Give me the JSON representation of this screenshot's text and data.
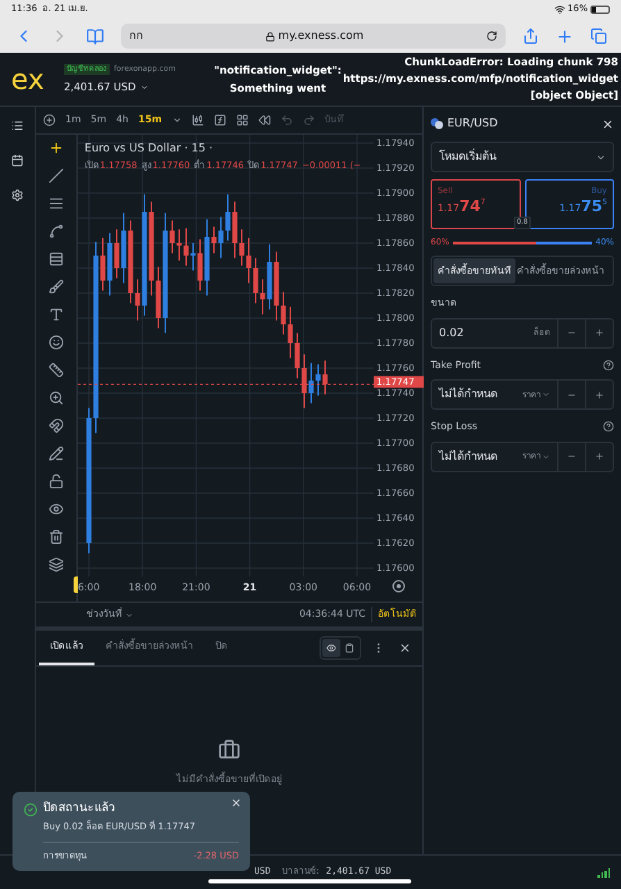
{
  "status_bar": {
    "time": "11:36",
    "date": "อ. 21 เม.ย.",
    "battery": "16%"
  },
  "browser": {
    "text_size_button": "กก",
    "address": "my.exness.com"
  },
  "header": {
    "logo": "ex",
    "account_badge": "บัญชีทดลอง",
    "server": "forexonapp.com",
    "balance": "2,401.67 USD",
    "widget_error": [
      "\"notification_widget\":",
      "Something went"
    ],
    "chunk_error": [
      "ChunkLoadError: Loading chunk 798",
      "https://my.exness.com/mfp/notification_widget",
      "[object Object]"
    ]
  },
  "chart_toolbar": {
    "timeframes": [
      {
        "label": "1m",
        "selected": false
      },
      {
        "label": "5m",
        "selected": false
      },
      {
        "label": "4h",
        "selected": false
      },
      {
        "label": "15m",
        "selected": true
      }
    ],
    "save_label": "บันทึ"
  },
  "chart": {
    "title": "Euro vs US Dollar · 15 ·",
    "ohlc": [
      {
        "label": "เปิด",
        "value": "1.17758"
      },
      {
        "label": "สูง",
        "value": "1.17760"
      },
      {
        "label": "ต่ำ",
        "value": "1.17746"
      },
      {
        "label": "ปิด",
        "value": "1.17747"
      }
    ],
    "change": "−0.00011 (−",
    "current_price": "1.17747",
    "chart_data": {
      "type": "candlestick",
      "ylim": [
        1.176,
        1.1794
      ],
      "grid": true,
      "ref_lines": [
        {
          "axis": "y",
          "value": 1.17747,
          "color": "#e04848"
        }
      ],
      "yticks": [
        {
          "value": 1.1794,
          "label": "1.17940"
        },
        {
          "value": 1.1792,
          "label": "1.17920"
        },
        {
          "value": 1.179,
          "label": "1.17900"
        },
        {
          "value": 1.1788,
          "label": "1.17880"
        },
        {
          "value": 1.1786,
          "label": "1.17860"
        },
        {
          "value": 1.1784,
          "label": "1.17840"
        },
        {
          "value": 1.1782,
          "label": "1.17820"
        },
        {
          "value": 1.178,
          "label": "1.17800"
        },
        {
          "value": 1.1778,
          "label": "1.17780"
        },
        {
          "value": 1.1776,
          "label": "1.17760"
        },
        {
          "value": 1.1774,
          "label": "1.17740"
        },
        {
          "value": 1.1772,
          "label": "1.17720"
        },
        {
          "value": 1.177,
          "label": "1.17700"
        },
        {
          "value": 1.1768,
          "label": "1.17680"
        },
        {
          "value": 1.1766,
          "label": "1.17660"
        },
        {
          "value": 1.1764,
          "label": "1.17640"
        },
        {
          "value": 1.1762,
          "label": "1.17620"
        },
        {
          "value": 1.176,
          "label": "1.17600"
        }
      ],
      "categories": [
        null,
        null,
        null,
        null,
        null,
        null,
        null,
        null,
        null,
        null,
        null,
        null,
        null,
        null,
        null,
        null,
        null,
        null,
        null,
        null,
        null,
        null,
        null,
        null,
        null,
        null,
        null,
        null,
        null,
        null,
        null,
        null,
        null,
        null,
        null
      ],
      "ohlc": [
        [
          1.1762,
          1.17728,
          1.17612,
          1.1772
        ],
        [
          1.1772,
          1.17861,
          1.17708,
          1.1785
        ],
        [
          1.1785,
          1.17864,
          1.17822,
          1.1783
        ],
        [
          1.1783,
          1.17868,
          1.17818,
          1.1786
        ],
        [
          1.1786,
          1.17871,
          1.17832,
          1.1784
        ],
        [
          1.1784,
          1.17884,
          1.17828,
          1.1787
        ],
        [
          1.1787,
          1.17878,
          1.17812,
          1.1782
        ],
        [
          1.1782,
          1.17831,
          1.17798,
          1.1781
        ],
        [
          1.1781,
          1.17899,
          1.17802,
          1.17885
        ],
        [
          1.17885,
          1.17893,
          1.17818,
          1.1783
        ],
        [
          1.1783,
          1.17841,
          1.17792,
          1.178
        ],
        [
          1.178,
          1.17884,
          1.17788,
          1.1787
        ],
        [
          1.1787,
          1.17878,
          1.17852,
          1.1786
        ],
        [
          1.1786,
          1.17871,
          1.17846,
          1.17858
        ],
        [
          1.17858,
          1.17872,
          1.17842,
          1.1785
        ],
        [
          1.1785,
          1.1786,
          1.17838,
          1.17852
        ],
        [
          1.17852,
          1.17863,
          1.17822,
          1.1783
        ],
        [
          1.1783,
          1.17879,
          1.17818,
          1.17865
        ],
        [
          1.17865,
          1.17873,
          1.17852,
          1.1786
        ],
        [
          1.1786,
          1.17881,
          1.17848,
          1.1787
        ],
        [
          1.1787,
          1.17899,
          1.17862,
          1.17885
        ],
        [
          1.17885,
          1.17893,
          1.17848,
          1.1786
        ],
        [
          1.1786,
          1.17871,
          1.17842,
          1.1785
        ],
        [
          1.1785,
          1.17864,
          1.17828,
          1.1784
        ],
        [
          1.1784,
          1.17848,
          1.17812,
          1.1782
        ],
        [
          1.1782,
          1.17831,
          1.17803,
          1.17815
        ],
        [
          1.17815,
          1.17859,
          1.17807,
          1.17845
        ],
        [
          1.17845,
          1.17853,
          1.17798,
          1.1781
        ],
        [
          1.1781,
          1.17821,
          1.17787,
          1.17795
        ],
        [
          1.17795,
          1.17809,
          1.17768,
          1.1778
        ],
        [
          1.1778,
          1.17788,
          1.17752,
          1.1776
        ],
        [
          1.1776,
          1.17771,
          1.17728,
          1.1774
        ],
        [
          1.1774,
          1.17764,
          1.17732,
          1.1775
        ],
        [
          1.1775,
          1.17763,
          1.17738,
          1.17755
        ],
        [
          1.17755,
          1.17766,
          1.17739,
          1.17747
        ]
      ]
    },
    "time_labels": [
      {
        "label": "6:00",
        "bold": false
      },
      {
        "label": "18:00",
        "bold": false
      },
      {
        "label": "21:00",
        "bold": false
      },
      {
        "label": "21",
        "bold": true
      },
      {
        "label": "03:00",
        "bold": false
      },
      {
        "label": "06:00",
        "bold": false
      }
    ],
    "range_button": "ช่วงวันที่",
    "clock": "04:36:44 UTC",
    "auto_button": "อัตโนมัติ"
  },
  "order_panel": {
    "symbol": "EUR/USD",
    "mode": "โหมดเริ่มต้น",
    "quotes": [
      {
        "kind": "sell",
        "label": "Sell",
        "price_prefix": "1.17",
        "price_big": "74",
        "price_sup": "7"
      },
      {
        "kind": "buy",
        "label": "Buy",
        "price_prefix": "1.17",
        "price_big": "75",
        "price_sup": "5"
      }
    ],
    "spread": "0.8",
    "sentiment": {
      "sell": "60%",
      "buy": "40%",
      "level": 0.6
    },
    "order_types": [
      {
        "label": "คำสั่งซื้อขายทันที",
        "selected": true
      },
      {
        "label": "คำสั่งซื้อขายล่วงหน้า",
        "selected": false
      }
    ],
    "volume": {
      "label": "ขนาด",
      "value": "0.02",
      "unit": "ล็อต"
    },
    "take_profit": {
      "label": "Take Profit",
      "value": "ไม่ได้กำหนด",
      "unit": "ราคา"
    },
    "stop_loss": {
      "label": "Stop Loss",
      "value": "ไม่ได้กำหนด",
      "unit": "ราคา"
    }
  },
  "positions_panel": {
    "view_modes": [
      {
        "selected": true
      },
      {
        "selected": false
      }
    ],
    "tabs": [
      {
        "label": "เปิดแล้ว",
        "selected": true
      },
      {
        "label": "คำสั่งซื้อขายล่วงหน้า",
        "selected": false
      },
      {
        "label": "ปิด",
        "selected": false
      }
    ],
    "empty_message": "ไม่มีคำสั่งซื้อขายที่เปิดอยู่"
  },
  "toast": {
    "title": "ปิดสถานะแล้ว",
    "detail": "Buy 0.02 ล็อต EUR/USD ที่ 1.17747",
    "loss_label": "การขาดทุน",
    "loss_value": "-2.28 USD"
  },
  "footer": {
    "currency": "USD",
    "balance_label": "บาลานซ์:",
    "balance": "2,401.67 USD"
  }
}
